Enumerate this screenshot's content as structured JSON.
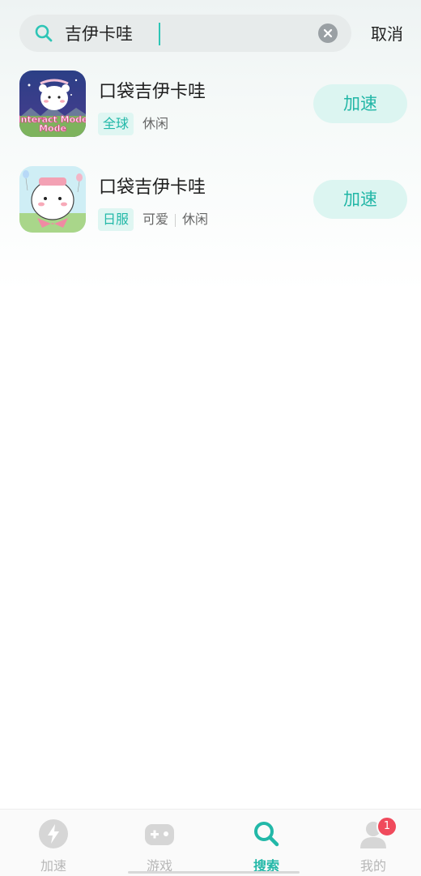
{
  "search": {
    "value": "吉伊卡哇",
    "cancel_label": "取消"
  },
  "results": [
    {
      "title": "口袋吉伊卡哇",
      "region_tag": "全球",
      "genre_tags": [
        "休闲"
      ],
      "action_label": "加速",
      "icon_text": "Interact Mode",
      "icon_badge_text": "Movie Event"
    },
    {
      "title": "口袋吉伊卡哇",
      "region_tag": "日服",
      "genre_tags": [
        "可爱",
        "休闲"
      ],
      "action_label": "加速",
      "icon_text": "",
      "icon_badge_text": ""
    }
  ],
  "bottom_nav": {
    "items": [
      {
        "label": "加速",
        "icon": "lightning-icon",
        "active": false
      },
      {
        "label": "游戏",
        "icon": "gamepad-icon",
        "active": false
      },
      {
        "label": "搜索",
        "icon": "search-icon",
        "active": true
      },
      {
        "label": "我的",
        "icon": "profile-icon",
        "active": false,
        "badge": "1"
      }
    ]
  },
  "colors": {
    "accent": "#22b8a8",
    "button_bg": "#dcf5f1",
    "badge_red": "#f04a5c"
  }
}
